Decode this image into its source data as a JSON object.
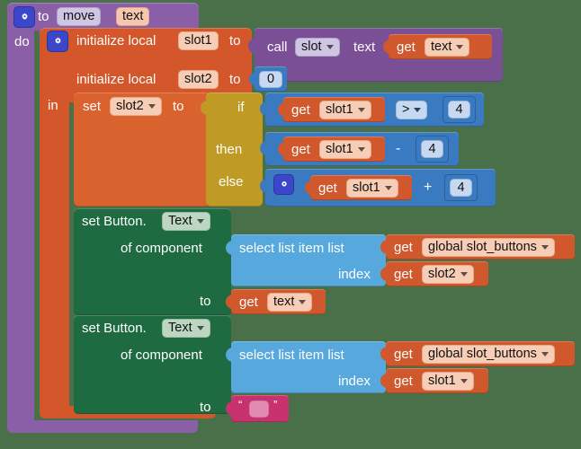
{
  "canvas": {
    "background": "#4a7049",
    "app": "MIT App Inventor Blocks Editor"
  },
  "colors": {
    "procedure": "#8b5fa8",
    "variable_local": "#d3572a",
    "variable_get": "#d0582c",
    "math": "#3a7ac0",
    "control": "#bf9b25",
    "list": "#56a8dd",
    "component_set": "#1e6b42",
    "text_string": "#c7316e",
    "mutator_icon": "#3b47c8"
  },
  "procedure": {
    "keyword_to": "to",
    "name": "move",
    "param": "text",
    "keyword_do": "do"
  },
  "local_init_1": {
    "label": "initialize local",
    "name": "slot1",
    "keyword_to": "to"
  },
  "call_block": {
    "keyword_call": "call",
    "target": "slot",
    "method": "text",
    "arg_get": "get",
    "arg_name": "text"
  },
  "local_init_2": {
    "label": "initialize local",
    "name": "slot2",
    "keyword_to": "to",
    "value": "0"
  },
  "keyword_in": "in",
  "set_slot2": {
    "keyword_set": "set",
    "name": "slot2",
    "keyword_to": "to"
  },
  "if_block": {
    "if_label": "if",
    "then_label": "then",
    "else_label": "else",
    "condition": {
      "get": "get",
      "var": "slot1",
      "operator": ">",
      "operand": "4"
    },
    "then_value": {
      "get": "get",
      "var": "slot1",
      "operator": "-",
      "operand": "4"
    },
    "else_value": {
      "get": "get",
      "var": "slot1",
      "operator": "+",
      "operand": "4"
    }
  },
  "set_button_1": {
    "prefix": "set Button.",
    "property": "Text",
    "of_component": "of component",
    "index_label": "index",
    "to_label": "to",
    "list_block": {
      "label": "select list item  list",
      "list_get": "get",
      "list_var": "global slot_buttons",
      "index_get": "get",
      "index_var": "slot2"
    },
    "value": {
      "get": "get",
      "var": "text"
    }
  },
  "set_button_2": {
    "prefix": "set Button.",
    "property": "Text",
    "of_component": "of component",
    "index_label": "index",
    "to_label": "to",
    "list_block": {
      "label": "select list item  list",
      "list_get": "get",
      "list_var": "global slot_buttons",
      "index_get": "get",
      "index_var": "slot1"
    },
    "empty_string": {
      "open_quote": "“",
      "close_quote": "”",
      "value": ""
    }
  }
}
